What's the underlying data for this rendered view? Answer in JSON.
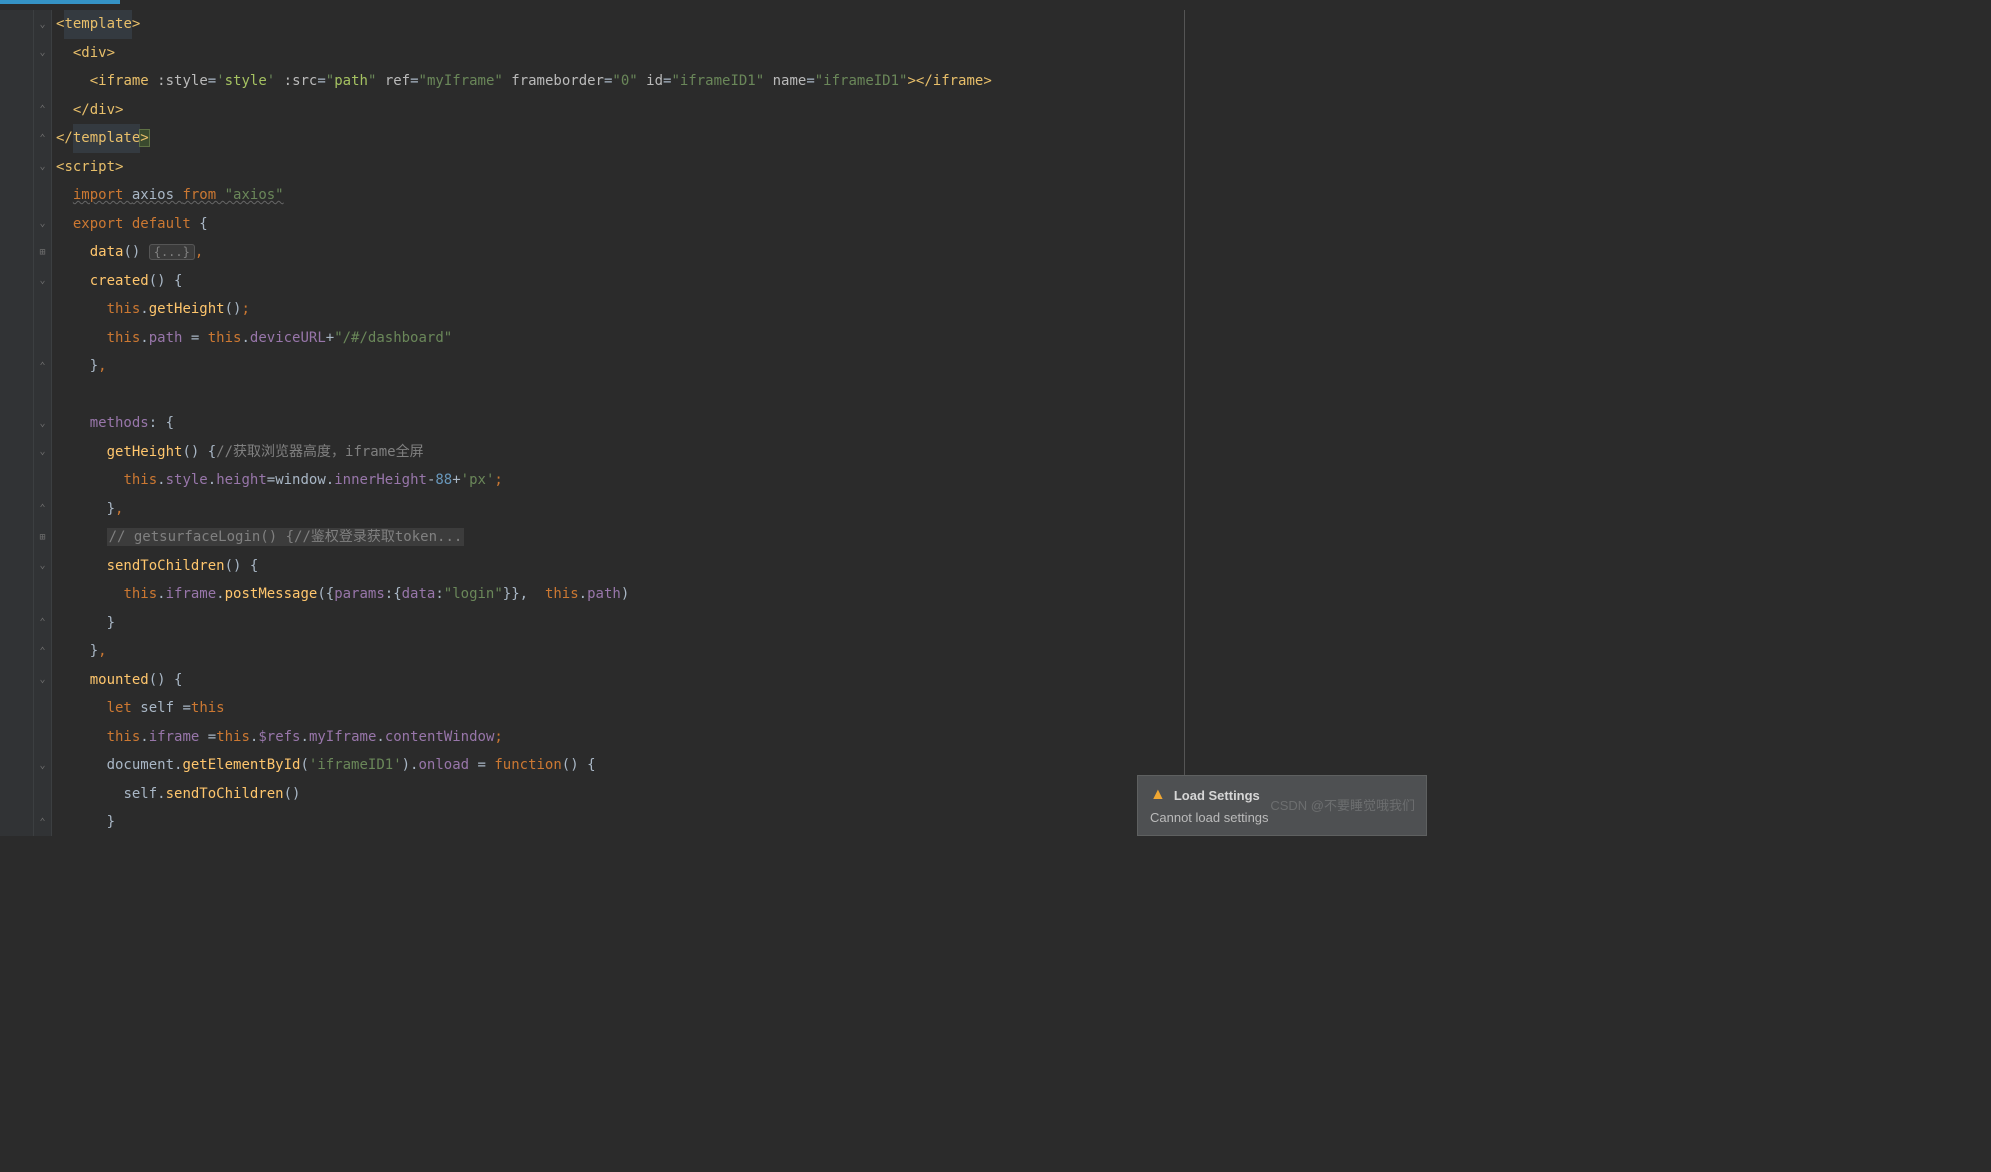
{
  "code": {
    "lines": [
      {
        "indent": 0,
        "fold": "down",
        "tokens": [
          [
            "<",
            "t-tag"
          ],
          [
            "template",
            "t-tag sel"
          ],
          [
            ">",
            "t-tag"
          ]
        ]
      },
      {
        "indent": 1,
        "fold": "down",
        "tokens": [
          [
            "<",
            "t-tag"
          ],
          [
            "div",
            "t-tag"
          ],
          [
            ">",
            "t-tag"
          ]
        ]
      },
      {
        "indent": 2,
        "fold": "",
        "tokens": [
          [
            "<",
            "t-tag"
          ],
          [
            "iframe ",
            "t-tag"
          ],
          [
            ":style",
            "t-attr"
          ],
          [
            "=",
            "t-txt"
          ],
          [
            "'",
            "t-str"
          ],
          [
            "style",
            "t-str2"
          ],
          [
            "' ",
            "t-str"
          ],
          [
            ":src",
            "t-attr"
          ],
          [
            "=",
            "t-txt"
          ],
          [
            "\"",
            "t-str"
          ],
          [
            "path",
            "t-str2"
          ],
          [
            "\" ",
            "t-str"
          ],
          [
            "ref",
            "t-attr"
          ],
          [
            "=",
            "t-txt"
          ],
          [
            "\"myIframe\" ",
            "t-str"
          ],
          [
            "frameborder",
            "t-attr"
          ],
          [
            "=",
            "t-txt"
          ],
          [
            "\"0\" ",
            "t-str"
          ],
          [
            "id",
            "t-attr"
          ],
          [
            "=",
            "t-txt"
          ],
          [
            "\"iframeID1\" ",
            "t-str"
          ],
          [
            "name",
            "t-attr"
          ],
          [
            "=",
            "t-txt"
          ],
          [
            "\"iframeID1\"",
            "t-str"
          ],
          [
            "></",
            "t-tag"
          ],
          [
            "iframe",
            "t-tag"
          ],
          [
            ">",
            "t-tag"
          ]
        ]
      },
      {
        "indent": 1,
        "fold": "up",
        "tokens": [
          [
            "</",
            "t-tag"
          ],
          [
            "div",
            "t-tag"
          ],
          [
            ">",
            "t-tag"
          ]
        ]
      },
      {
        "indent": 0,
        "fold": "up",
        "tokens": [
          [
            "</",
            "t-tag"
          ],
          [
            "template",
            "t-tag sel"
          ],
          [
            ">",
            "t-tag caret-box"
          ]
        ]
      },
      {
        "indent": 0,
        "fold": "down",
        "tokens": [
          [
            "<",
            "t-tag"
          ],
          [
            "script",
            "t-tag"
          ],
          [
            ">",
            "t-tag"
          ]
        ]
      },
      {
        "indent": 1,
        "fold": "",
        "tokens": [
          [
            "import ",
            "t-kw underline"
          ],
          [
            "axios ",
            "t-txt underline"
          ],
          [
            "from ",
            "t-kw underline"
          ],
          [
            "\"axios\"",
            "t-str underline"
          ]
        ]
      },
      {
        "indent": 1,
        "fold": "down",
        "tokens": [
          [
            "export default ",
            "t-kw"
          ],
          [
            "{",
            "t-br"
          ]
        ]
      },
      {
        "indent": 2,
        "fold": "plus",
        "tokens": [
          [
            "data",
            "t-fn"
          ],
          [
            "() ",
            "t-br"
          ],
          [
            "{...}",
            "folded"
          ],
          [
            ",",
            "t-punct"
          ]
        ]
      },
      {
        "indent": 2,
        "fold": "down",
        "tokens": [
          [
            "created",
            "t-fn"
          ],
          [
            "() {",
            "t-br"
          ]
        ]
      },
      {
        "indent": 3,
        "fold": "",
        "tokens": [
          [
            "this",
            "t-kw"
          ],
          [
            ".",
            "t-txt"
          ],
          [
            "getHeight",
            "t-fn"
          ],
          [
            "()",
            "t-br"
          ],
          [
            ";",
            "t-punct"
          ]
        ]
      },
      {
        "indent": 3,
        "fold": "",
        "tokens": [
          [
            "this",
            "t-kw"
          ],
          [
            ".",
            "t-txt"
          ],
          [
            "path ",
            "t-prop"
          ],
          [
            "= ",
            "t-txt"
          ],
          [
            "this",
            "t-kw"
          ],
          [
            ".",
            "t-txt"
          ],
          [
            "deviceURL",
            "t-prop"
          ],
          [
            "+",
            "t-txt"
          ],
          [
            "\"/#/dashboard\"",
            "t-str"
          ]
        ]
      },
      {
        "indent": 2,
        "fold": "up",
        "tokens": [
          [
            "}",
            "t-br"
          ],
          [
            ",",
            "t-punct"
          ]
        ]
      },
      {
        "indent": 0,
        "fold": "",
        "tokens": []
      },
      {
        "indent": 2,
        "fold": "down",
        "tokens": [
          [
            "methods",
            "t-prop"
          ],
          [
            ": {",
            "t-br"
          ]
        ]
      },
      {
        "indent": 3,
        "fold": "down",
        "tokens": [
          [
            "getHeight",
            "t-fn"
          ],
          [
            "() {",
            "t-br"
          ],
          [
            "//获取浏览器高度，iframe全屏",
            "t-cm"
          ]
        ]
      },
      {
        "indent": 4,
        "fold": "",
        "tokens": [
          [
            "this",
            "t-kw"
          ],
          [
            ".",
            "t-txt"
          ],
          [
            "style",
            "t-prop"
          ],
          [
            ".",
            "t-txt"
          ],
          [
            "height",
            "t-prop"
          ],
          [
            "=",
            "t-txt"
          ],
          [
            "window",
            "t-txt"
          ],
          [
            ".",
            "t-txt"
          ],
          [
            "innerHeight",
            "t-prop"
          ],
          [
            "-",
            "t-txt"
          ],
          [
            "88",
            "t-num"
          ],
          [
            "+",
            "t-txt"
          ],
          [
            "'px'",
            "t-str"
          ],
          [
            ";",
            "t-punct"
          ]
        ]
      },
      {
        "indent": 3,
        "fold": "up",
        "tokens": [
          [
            "}",
            "t-br"
          ],
          [
            ",",
            "t-punct"
          ]
        ]
      },
      {
        "indent": 3,
        "fold": "plus",
        "tokens": [
          [
            "// getsurfaceLogin() {//鉴权登录获取token...",
            "cm-block"
          ]
        ]
      },
      {
        "indent": 3,
        "fold": "down",
        "tokens": [
          [
            "sendToChildren",
            "t-fn"
          ],
          [
            "() {",
            "t-br"
          ]
        ]
      },
      {
        "indent": 4,
        "fold": "",
        "tokens": [
          [
            "this",
            "t-kw"
          ],
          [
            ".",
            "t-txt"
          ],
          [
            "iframe",
            "t-prop"
          ],
          [
            ".",
            "t-txt"
          ],
          [
            "postMessage",
            "t-fn"
          ],
          [
            "({",
            "t-br"
          ],
          [
            "params",
            "t-prop"
          ],
          [
            ":{",
            "t-br"
          ],
          [
            "data",
            "t-prop"
          ],
          [
            ":",
            "t-txt"
          ],
          [
            "\"login\"",
            "t-str"
          ],
          [
            "}},  ",
            "t-br"
          ],
          [
            "this",
            "t-kw"
          ],
          [
            ".",
            "t-txt"
          ],
          [
            "path",
            "t-prop"
          ],
          [
            ")",
            "t-br"
          ]
        ]
      },
      {
        "indent": 3,
        "fold": "up",
        "tokens": [
          [
            "}",
            "t-br"
          ]
        ]
      },
      {
        "indent": 2,
        "fold": "up",
        "tokens": [
          [
            "}",
            "t-br"
          ],
          [
            ",",
            "t-punct"
          ]
        ]
      },
      {
        "indent": 2,
        "fold": "down",
        "tokens": [
          [
            "mounted",
            "t-fn"
          ],
          [
            "() {",
            "t-br"
          ]
        ]
      },
      {
        "indent": 3,
        "fold": "",
        "tokens": [
          [
            "let ",
            "t-kw"
          ],
          [
            "self ",
            "t-txt"
          ],
          [
            "=",
            "t-txt"
          ],
          [
            "this",
            "t-kw"
          ]
        ]
      },
      {
        "indent": 3,
        "fold": "",
        "tokens": [
          [
            "this",
            "t-kw"
          ],
          [
            ".",
            "t-txt"
          ],
          [
            "iframe ",
            "t-prop"
          ],
          [
            "=",
            "t-txt"
          ],
          [
            "this",
            "t-kw"
          ],
          [
            ".",
            "t-txt"
          ],
          [
            "$refs",
            "t-prop"
          ],
          [
            ".",
            "t-txt"
          ],
          [
            "myIframe",
            "t-prop"
          ],
          [
            ".",
            "t-txt"
          ],
          [
            "contentWindow",
            "t-prop"
          ],
          [
            ";",
            "t-punct"
          ]
        ]
      },
      {
        "indent": 3,
        "fold": "down",
        "tokens": [
          [
            "document",
            "t-txt"
          ],
          [
            ".",
            "t-txt"
          ],
          [
            "getElementById",
            "t-fn"
          ],
          [
            "(",
            "t-br"
          ],
          [
            "'iframeID1'",
            "t-str"
          ],
          [
            ").",
            "t-br"
          ],
          [
            "onload ",
            "t-prop"
          ],
          [
            "= ",
            "t-txt"
          ],
          [
            "function",
            "t-kw"
          ],
          [
            "() {",
            "t-br"
          ]
        ]
      },
      {
        "indent": 4,
        "fold": "",
        "tokens": [
          [
            "self",
            "t-txt"
          ],
          [
            ".",
            "t-txt"
          ],
          [
            "sendToChildren",
            "t-fn"
          ],
          [
            "()",
            "t-br"
          ]
        ]
      },
      {
        "indent": 3,
        "fold": "up",
        "tokens": [
          [
            "}",
            "t-br"
          ]
        ]
      }
    ]
  },
  "notification": {
    "title": "Load Settings",
    "body": "Cannot load settings"
  },
  "watermark": "CSDN @不要睡觉哦我们"
}
